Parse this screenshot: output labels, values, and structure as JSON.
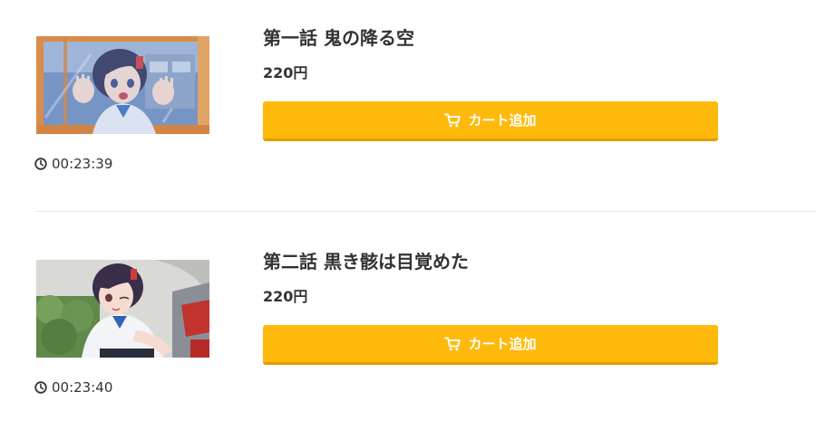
{
  "episodes": [
    {
      "title": "第一話 鬼の降る空",
      "price": "220円",
      "cart_label": "カート追加",
      "duration": "00:23:39"
    },
    {
      "title": "第二話 黒き骸は目覚めた",
      "price": "220円",
      "cart_label": "カート追加",
      "duration": "00:23:40"
    }
  ],
  "colors": {
    "button": "#ffb90a",
    "button_border": "#e29c00",
    "text": "#333333"
  }
}
